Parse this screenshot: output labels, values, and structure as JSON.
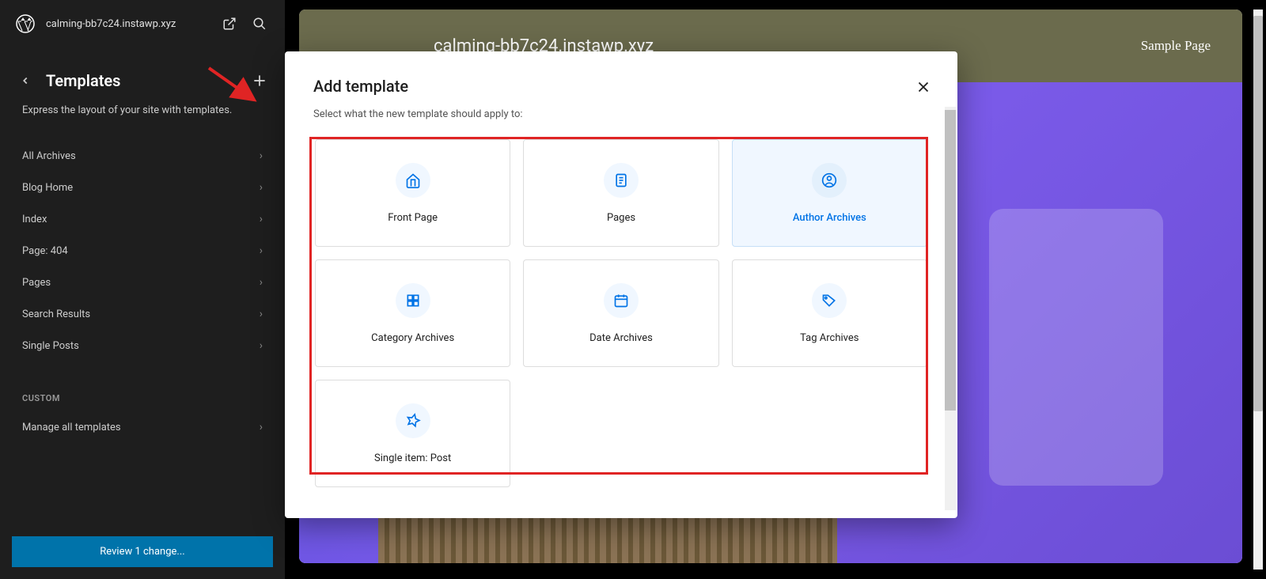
{
  "sidebar": {
    "site_name": "calming-bb7c24.instawp.xyz",
    "title": "Templates",
    "desc": "Express the layout of your site with templates.",
    "items": [
      {
        "label": "All Archives"
      },
      {
        "label": "Blog Home"
      },
      {
        "label": "Index"
      },
      {
        "label": "Page: 404"
      },
      {
        "label": "Pages"
      },
      {
        "label": "Search Results"
      },
      {
        "label": "Single Posts"
      }
    ],
    "custom_heading": "CUSTOM",
    "manage_label": "Manage all templates",
    "review_label": "Review 1 change..."
  },
  "preview": {
    "site_url": "calming-bb7c24.instawp.xyz",
    "menu_item": "Sample Page"
  },
  "modal": {
    "title": "Add template",
    "subtitle": "Select what the new template should apply to:",
    "options": [
      {
        "id": "front-page",
        "label": "Front Page",
        "icon": "home"
      },
      {
        "id": "pages",
        "label": "Pages",
        "icon": "page"
      },
      {
        "id": "author-archives",
        "label": "Author Archives",
        "icon": "user",
        "active": true
      },
      {
        "id": "category-archives",
        "label": "Category Archives",
        "icon": "grid"
      },
      {
        "id": "date-archives",
        "label": "Date Archives",
        "icon": "calendar"
      },
      {
        "id": "tag-archives",
        "label": "Tag Archives",
        "icon": "tag"
      },
      {
        "id": "single-item-post",
        "label": "Single item: Post",
        "icon": "pin"
      }
    ]
  },
  "colors": {
    "accent": "#0073e6",
    "danger": "#e02424",
    "review": "#0073aa"
  }
}
